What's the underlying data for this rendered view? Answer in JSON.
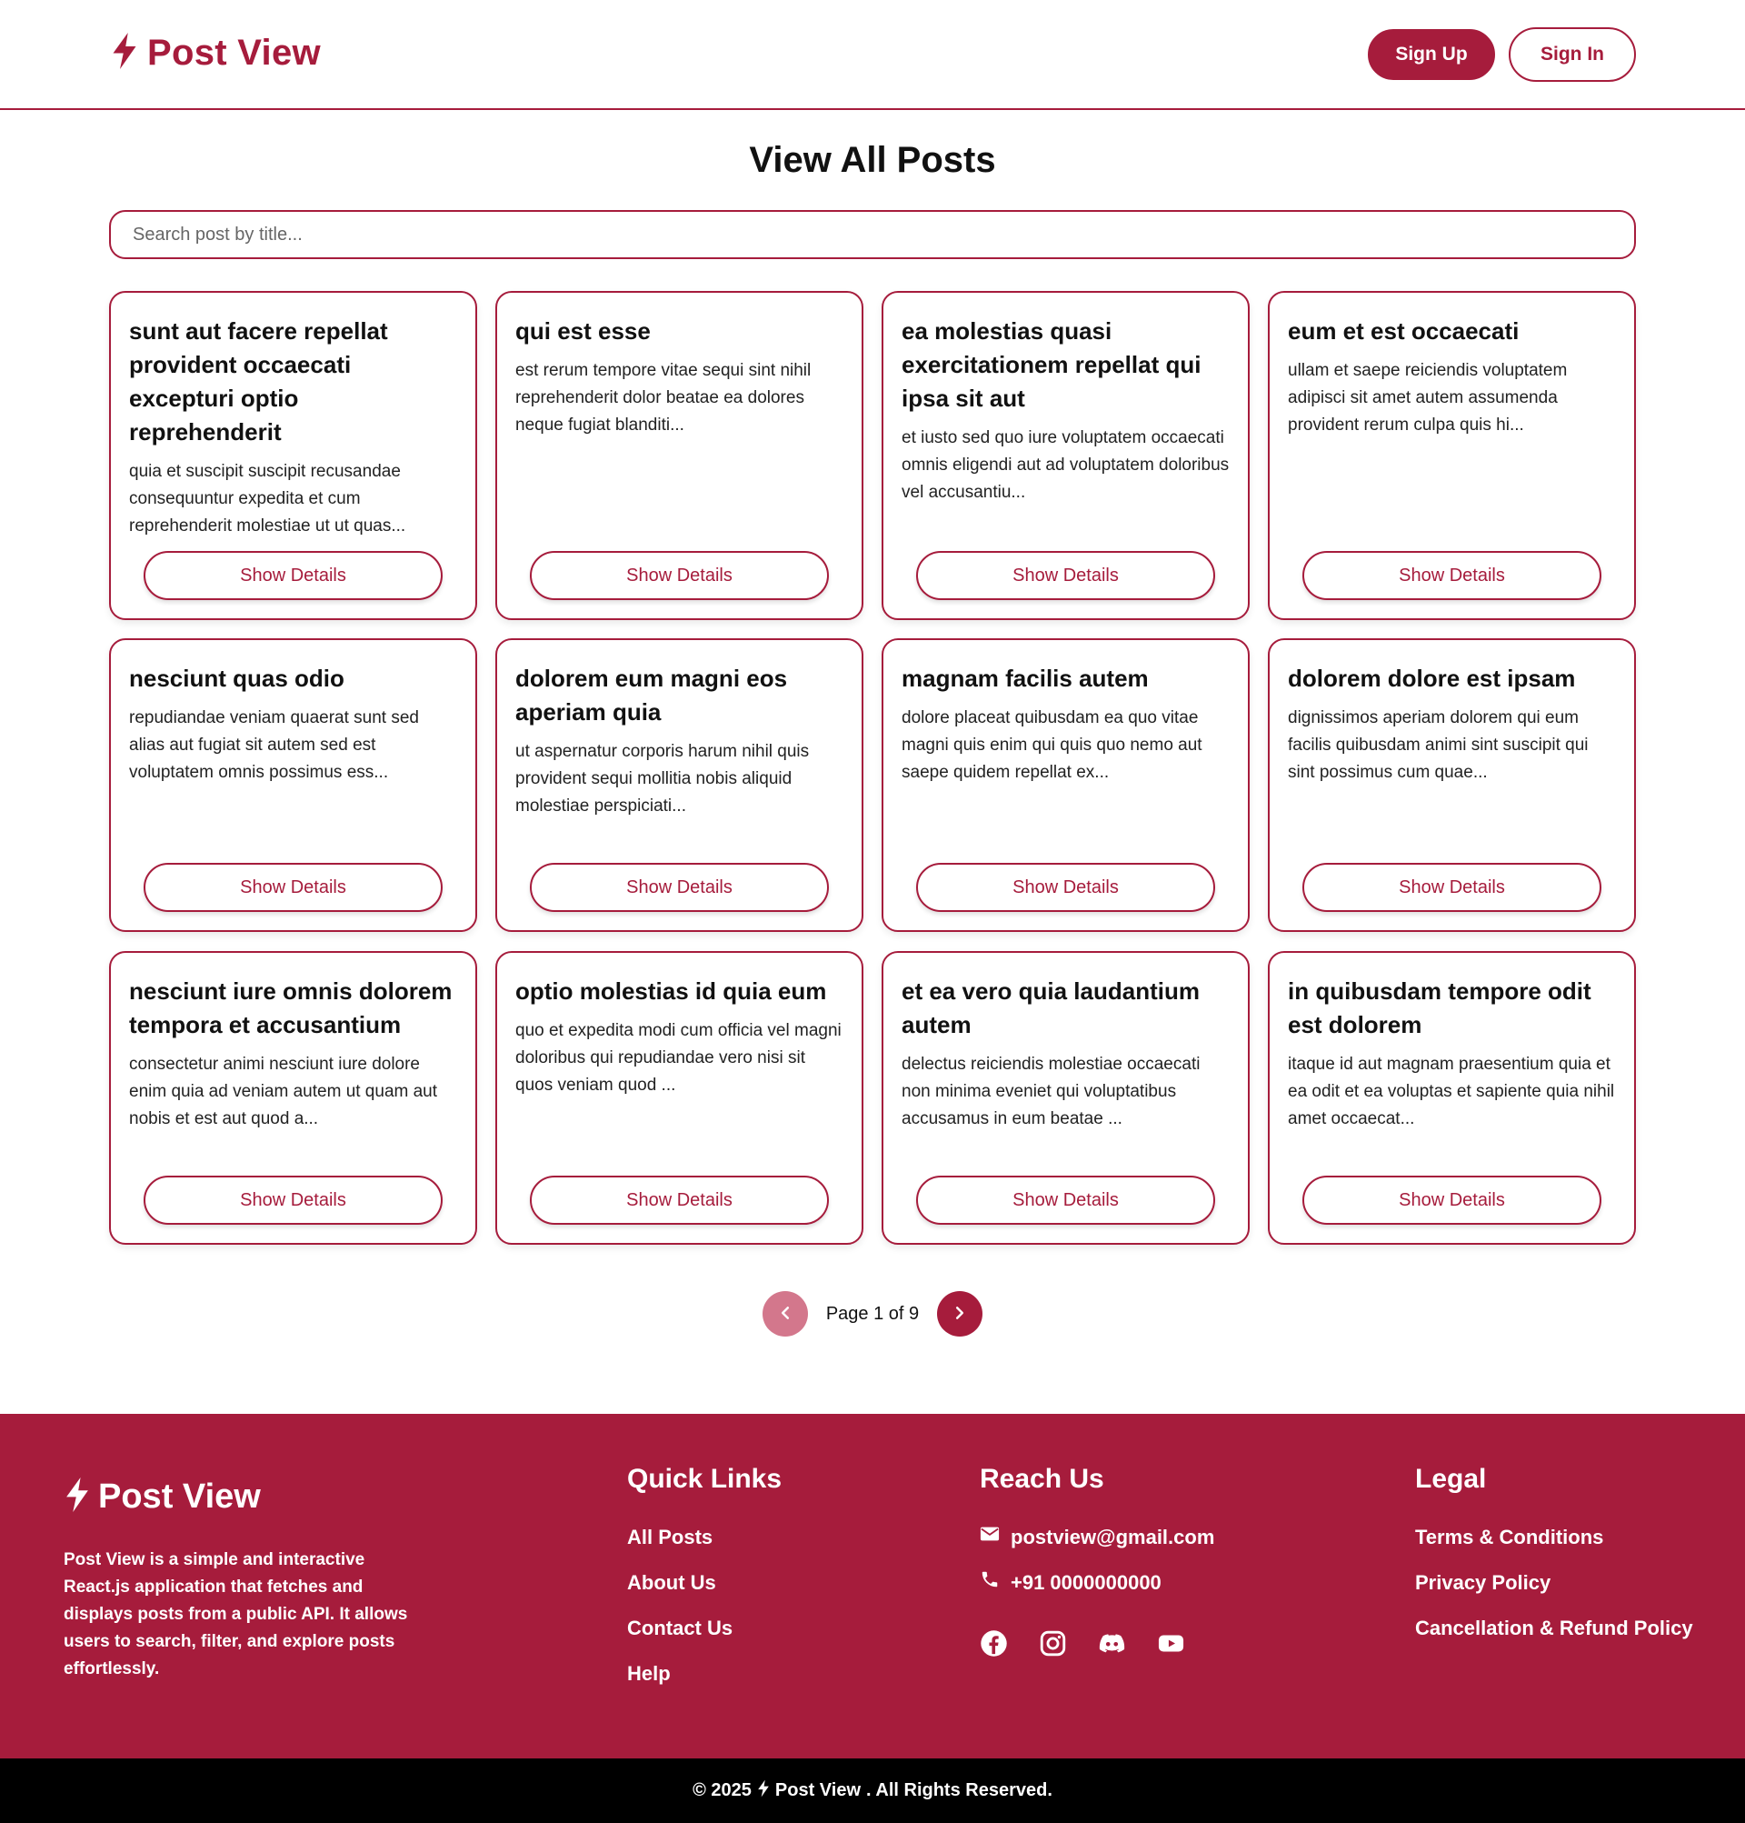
{
  "header": {
    "brand": "Post View",
    "signup_label": "Sign Up",
    "signin_label": "Sign In"
  },
  "main": {
    "title": "View All Posts",
    "search_placeholder": "Search post by title...",
    "show_details_label": "Show Details",
    "posts": [
      {
        "title": "sunt aut facere repellat provident occaecati excepturi optio reprehenderit",
        "body": "quia et suscipit suscipit recusandae consequuntur expedita et cum reprehenderit molestiae ut ut quas..."
      },
      {
        "title": "qui est esse",
        "body": "est rerum tempore vitae sequi sint nihil reprehenderit dolor beatae ea dolores neque fugiat blanditi..."
      },
      {
        "title": "ea molestias quasi exercitationem repellat qui ipsa sit aut",
        "body": "et iusto sed quo iure voluptatem occaecati omnis eligendi aut ad voluptatem doloribus vel accusantiu..."
      },
      {
        "title": "eum et est occaecati",
        "body": "ullam et saepe reiciendis voluptatem adipisci sit amet autem assumenda provident rerum culpa quis hi..."
      },
      {
        "title": "nesciunt quas odio",
        "body": "repudiandae veniam quaerat sunt sed alias aut fugiat sit autem sed est voluptatem omnis possimus ess..."
      },
      {
        "title": "dolorem eum magni eos aperiam quia",
        "body": "ut aspernatur corporis harum nihil quis provident sequi mollitia nobis aliquid molestiae perspiciati..."
      },
      {
        "title": "magnam facilis autem",
        "body": "dolore placeat quibusdam ea quo vitae magni quis enim qui quis quo nemo aut saepe quidem repellat ex..."
      },
      {
        "title": "dolorem dolore est ipsam",
        "body": "dignissimos aperiam dolorem qui eum facilis quibusdam animi sint suscipit qui sint possimus cum quae..."
      },
      {
        "title": "nesciunt iure omnis dolorem tempora et accusantium",
        "body": "consectetur animi nesciunt iure dolore enim quia ad veniam autem ut quam aut nobis et est aut quod a..."
      },
      {
        "title": "optio molestias id quia eum",
        "body": "quo et expedita modi cum officia vel magni doloribus qui repudiandae vero nisi sit quos veniam quod ..."
      },
      {
        "title": "et ea vero quia laudantium autem",
        "body": "delectus reiciendis molestiae occaecati non minima eveniet qui voluptatibus accusamus in eum beatae ..."
      },
      {
        "title": "in quibusdam tempore odit est dolorem",
        "body": "itaque id aut magnam praesentium quia et ea odit et ea voluptas et sapiente quia nihil amet occaecat..."
      }
    ],
    "pagination": {
      "page_text": "Page 1 of 9",
      "current_page": 1,
      "total_pages": 9
    }
  },
  "footer": {
    "brand": "Post View",
    "description": "Post View is a simple and interactive React.js application that fetches and displays posts from a public API. It allows users to search, filter, and explore posts effortlessly.",
    "quick_links": {
      "title": "Quick Links",
      "items": [
        "All Posts",
        "About Us",
        "Contact Us",
        "Help"
      ]
    },
    "reach_us": {
      "title": "Reach Us",
      "email": "postview@gmail.com",
      "phone": "+91 0000000000",
      "socials": [
        "facebook-icon",
        "instagram-icon",
        "discord-icon",
        "youtube-icon"
      ]
    },
    "legal": {
      "title": "Legal",
      "items": [
        "Terms & Conditions",
        "Privacy Policy",
        "Cancellation & Refund Policy"
      ]
    },
    "copyright_prefix": "© 2025",
    "copyright_brand": "Post View",
    "copyright_suffix": ". All Rights Reserved."
  },
  "colors": {
    "accent": "#a61c3c",
    "accent_light": "#d3778c",
    "footer_bottom": "#000000"
  }
}
